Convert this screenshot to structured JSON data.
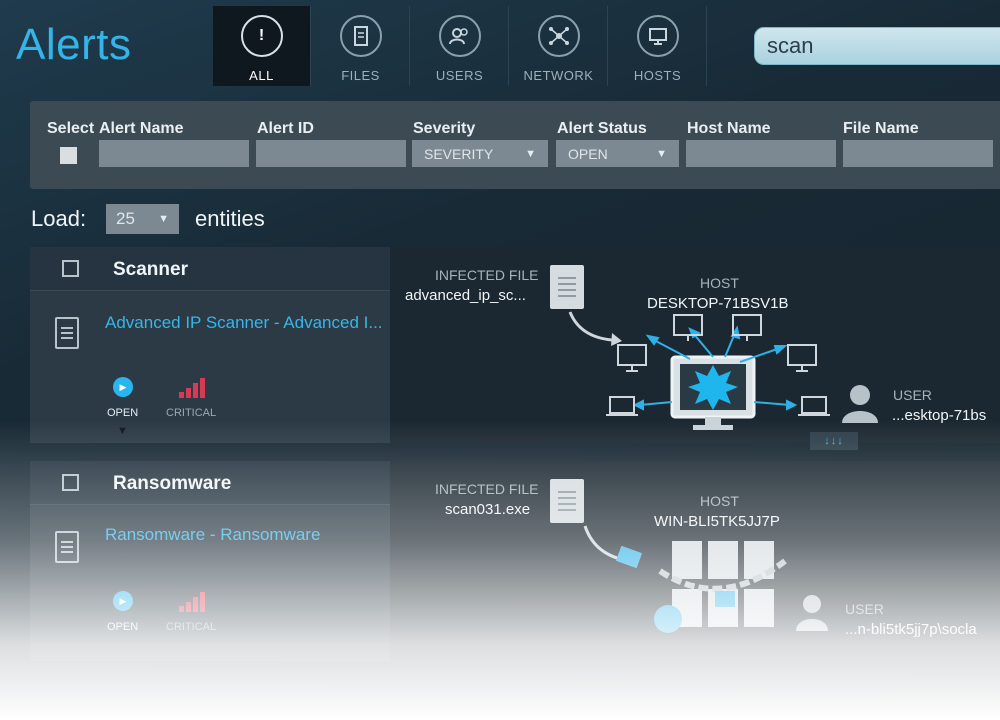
{
  "header": {
    "title": "Alerts",
    "tabs": [
      {
        "label": "ALL",
        "icon": "alert-icon"
      },
      {
        "label": "FILES",
        "icon": "file-icon"
      },
      {
        "label": "USERS",
        "icon": "users-icon"
      },
      {
        "label": "NETWORK",
        "icon": "network-icon"
      },
      {
        "label": "HOSTS",
        "icon": "hosts-icon"
      }
    ],
    "search_value": "scan"
  },
  "filters": {
    "select_label": "Select",
    "alert_name_label": "Alert Name",
    "alert_id_label": "Alert ID",
    "severity_label": "Severity",
    "severity_value": "SEVERITY",
    "alert_status_label": "Alert Status",
    "alert_status_value": "OPEN",
    "host_name_label": "Host Name",
    "file_name_label": "File Name"
  },
  "load": {
    "label": "Load:",
    "value": "25",
    "suffix": "entities"
  },
  "alerts": [
    {
      "category": "Scanner",
      "name": "Advanced IP Scanner - Advanced I...",
      "status": "OPEN",
      "severity": "CRITICAL",
      "infected_file_label": "INFECTED FILE",
      "infected_file": "advanced_ip_sc...",
      "host_label": "HOST",
      "host": "DESKTOP-71BSV1B",
      "user_label": "USER",
      "user": "...esktop-71bs",
      "expand": "↓↓↓"
    },
    {
      "category": "Ransomware",
      "name": "Ransomware - Ransomware",
      "status": "OPEN",
      "severity": "CRITICAL",
      "infected_file_label": "INFECTED FILE",
      "infected_file": "scan031.exe",
      "host_label": "HOST",
      "host": "WIN-BLI5TK5JJ7P",
      "user_label": "USER",
      "user": "...n-bli5tk5jj7p\\socla"
    }
  ],
  "colors": {
    "accent": "#34b4e8",
    "critical": "#d73a52"
  }
}
